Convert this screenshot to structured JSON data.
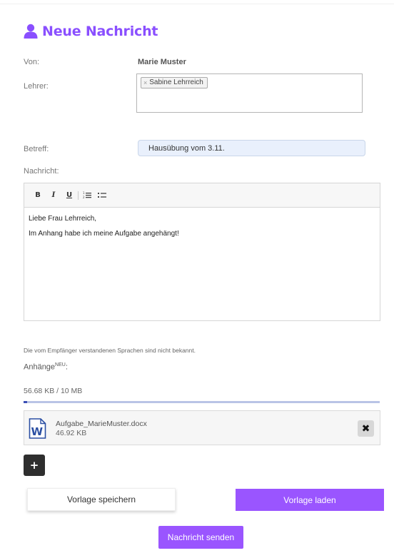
{
  "header": {
    "title": "Neue Nachricht",
    "icon": "user-icon",
    "accent_color": "#8a4fff"
  },
  "form": {
    "from_label": "Von:",
    "from_value": "Marie Muster",
    "to_label": "Lehrer:",
    "recipients": [
      {
        "name": "Sabine Lehrreich",
        "remove_symbol": "×"
      }
    ],
    "subject_label": "Betreff:",
    "subject_value": "Hausübung vom 3.11.",
    "message_label": "Nachricht:"
  },
  "editor": {
    "toolbar": {
      "bold": "B",
      "italic": "I",
      "underline": "U"
    },
    "lines": [
      "Liebe Frau Lehrreich,",
      "Im Anhang habe ich meine Aufgabe angehängt!"
    ]
  },
  "language_note": "Die vom Empfänger verstandenen Sprachen sind nicht bekannt.",
  "attachments": {
    "label": "Anhänge",
    "badge": "NEU",
    "label_suffix": ":",
    "usage": "56.68 KB / 10 MB",
    "usage_fraction": 0.0055,
    "files": [
      {
        "name": "Aufgabe_MarieMuster.docx",
        "size": "46.92 KB",
        "icon": "word-document-icon"
      }
    ],
    "delete_symbol": "✖",
    "add_symbol": "+"
  },
  "buttons": {
    "save_template": "Vorlage speichern",
    "load_template": "Vorlage laden",
    "send": "Nachricht senden"
  },
  "colors": {
    "primary": "#9a55ff",
    "progress": "#3b4fb5"
  }
}
